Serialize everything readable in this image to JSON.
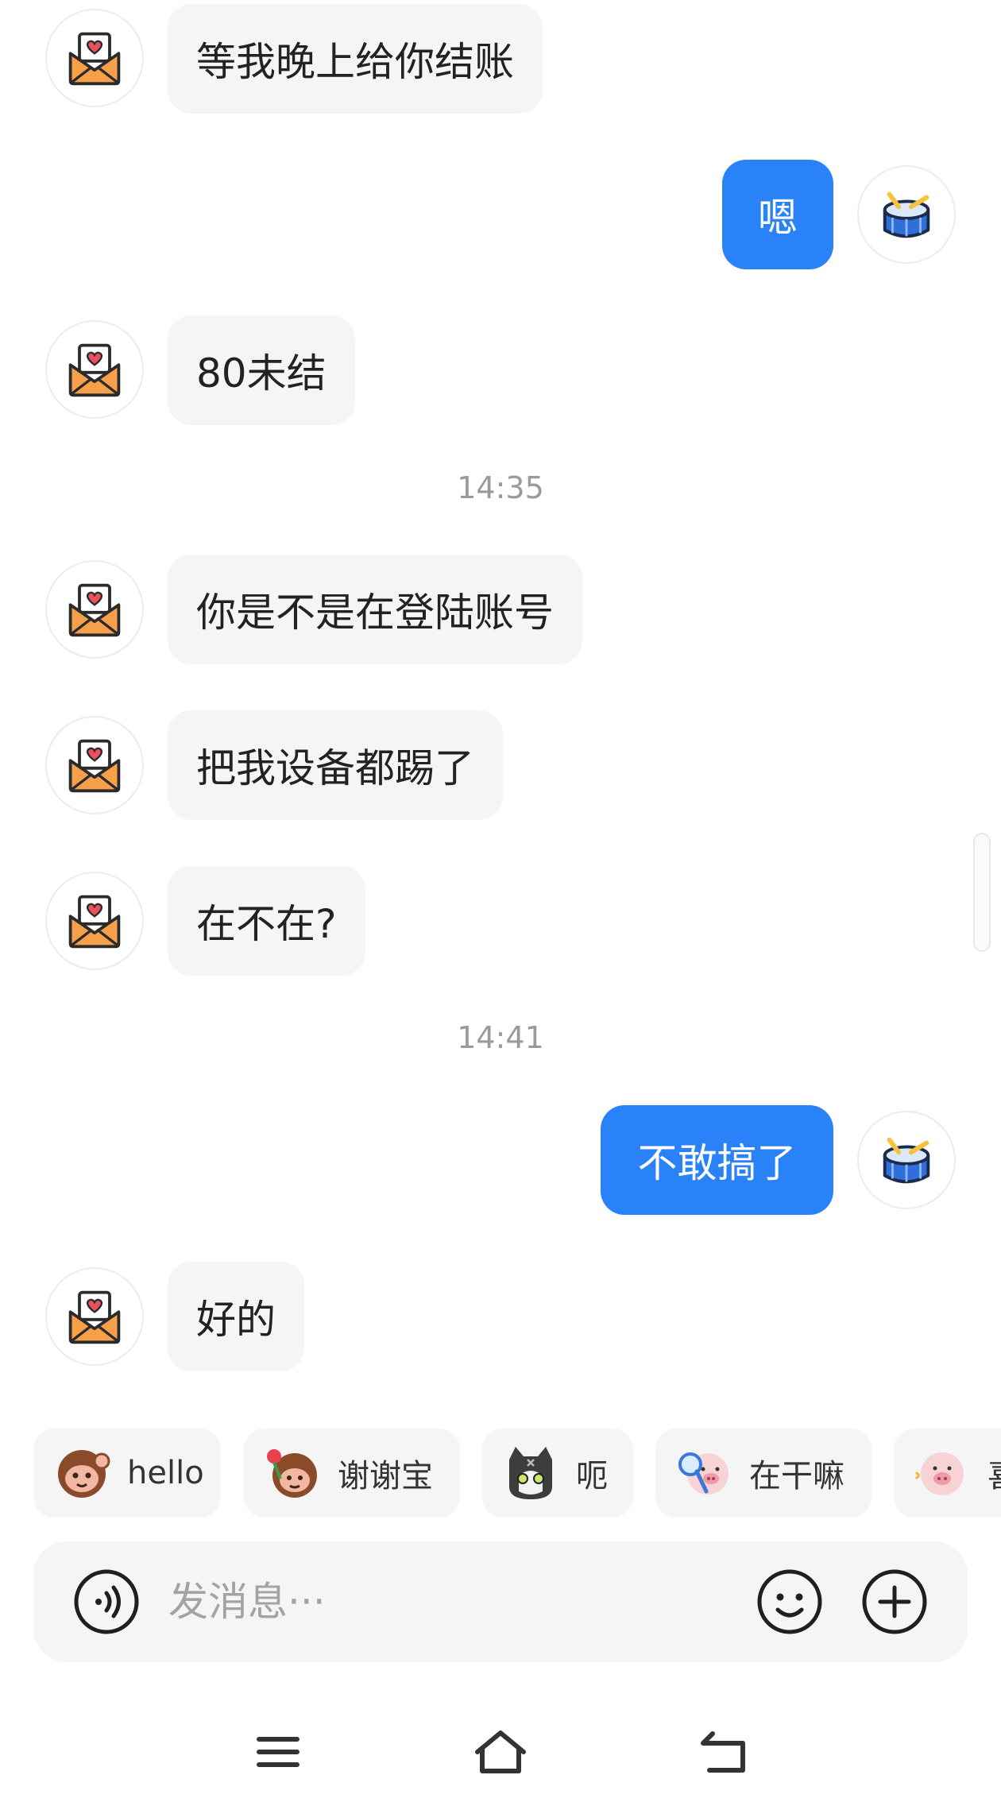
{
  "messages": [
    {
      "side": "in",
      "text": "等我晚上给你结账"
    },
    {
      "side": "out",
      "text": "嗯"
    },
    {
      "side": "in",
      "text": "80未结"
    },
    {
      "side": "in",
      "text": "你是不是在登陆账号"
    },
    {
      "side": "in",
      "text": "把我设备都踢了"
    },
    {
      "side": "in",
      "text": "在不在?"
    },
    {
      "side": "out",
      "text": "不敢搞了"
    },
    {
      "side": "in",
      "text": "好的"
    }
  ],
  "timestamps": [
    "14:35",
    "14:41"
  ],
  "contact_avatar": "heart-envelope-icon",
  "self_avatar": "drum-icon",
  "quick_replies": [
    {
      "sticker": "monkey-waving-sticker",
      "label": "hello"
    },
    {
      "sticker": "monkey-flower-sticker",
      "label": "谢谢宝"
    },
    {
      "sticker": "cat-sticker",
      "label": "呃"
    },
    {
      "sticker": "pig-magnifier-sticker",
      "label": "在干嘛"
    },
    {
      "sticker": "pig-sticker",
      "label": "喜"
    }
  ],
  "input": {
    "placeholder": "发消息···"
  },
  "colors": {
    "outgoing_bubble": "#2a82f9",
    "incoming_bubble": "#f5f5f5",
    "timestamp": "#9a9a9a"
  },
  "icons": {
    "voice": "voice-icon",
    "emoji": "emoji-icon",
    "plus": "plus-icon",
    "nav_menu": "menu-icon",
    "nav_home": "home-icon",
    "nav_back": "back-icon"
  }
}
